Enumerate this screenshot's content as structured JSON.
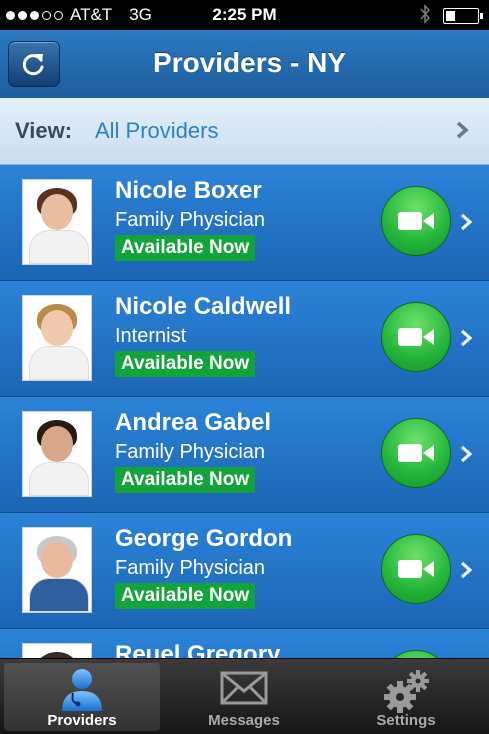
{
  "status_bar": {
    "signal_bars": 3,
    "carrier": "AT&T",
    "network": "3G",
    "time": "2:25 PM",
    "battery_level": 0.3
  },
  "nav": {
    "title": "Providers - NY",
    "refresh_icon": "refresh-icon"
  },
  "view_filter": {
    "label": "View:",
    "value": "All Providers"
  },
  "providers": [
    {
      "name": "Nicole Boxer",
      "specialty": "Family Physician",
      "status": "Available Now"
    },
    {
      "name": "Nicole Caldwell",
      "specialty": "Internist",
      "status": "Available Now"
    },
    {
      "name": "Andrea Gabel",
      "specialty": "Family Physician",
      "status": "Available Now"
    },
    {
      "name": "George Gordon",
      "specialty": "Family Physician",
      "status": "Available Now"
    },
    {
      "name": "Reuel Gregory",
      "specialty": "",
      "status": ""
    }
  ],
  "tabs": [
    {
      "label": "Providers",
      "icon": "doctor-icon",
      "active": true
    },
    {
      "label": "Messages",
      "icon": "envelope-icon",
      "active": false
    },
    {
      "label": "Settings",
      "icon": "gears-icon",
      "active": false
    }
  ],
  "colors": {
    "available": "#12a33a",
    "accent": "#2f7fc9"
  }
}
